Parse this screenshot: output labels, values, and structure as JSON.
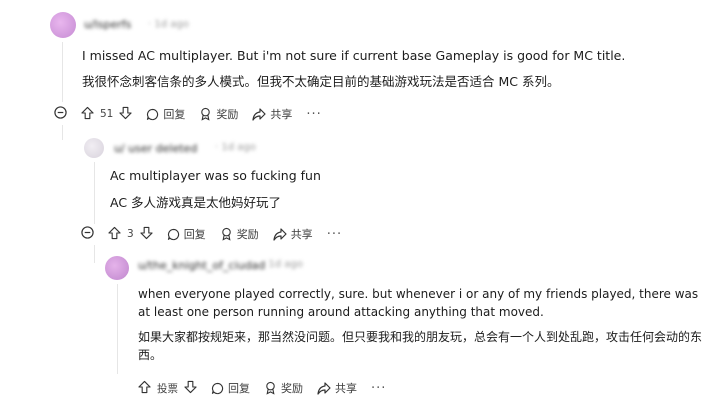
{
  "comments": [
    {
      "username": "u/lsperfs",
      "timestamp": "· 1d ago",
      "text_en": "I missed AC multiplayer. But i'm not sure if current base Gameplay is good for MC title.",
      "text_zh": "我很怀念刺客信条的多人模式。但我不太确定目前的基础游戏玩法是否适合 MC 系列。",
      "votes": "51",
      "reply_label": "回复",
      "award_label": "奖励",
      "share_label": "共享",
      "more_label": "···"
    },
    {
      "username": "u/ user deleted",
      "timestamp": "· 1d ago",
      "text_en": "Ac multiplayer was so fucking fun",
      "text_zh": "AC 多人游戏真是太他妈好玩了",
      "votes": "3",
      "reply_label": "回复",
      "award_label": "奖励",
      "share_label": "共享",
      "more_label": "···"
    },
    {
      "username": "u/the_knight_of_ciudad",
      "timestamp": "· 1d ago",
      "text_en": "when everyone played correctly, sure. but whenever i or any of my friends played, there was at least one person running around attacking anything that moved.",
      "text_zh": "如果大家都按规矩来，那当然没问题。但只要我和我的朋友玩，总会有一个人到处乱跑，攻击任何会动的东西。",
      "vote_label": "投票",
      "reply_label": "回复",
      "award_label": "奖励",
      "share_label": "共享",
      "more_label": "···"
    }
  ]
}
